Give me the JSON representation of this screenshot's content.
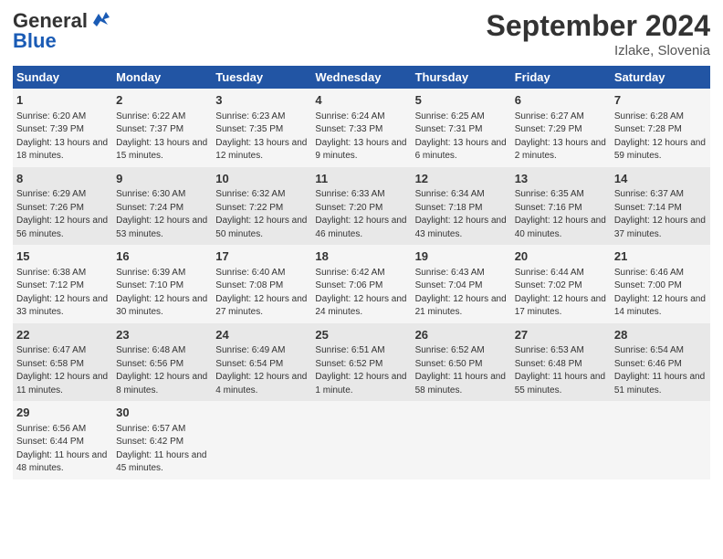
{
  "header": {
    "logo_line1": "General",
    "logo_line2": "Blue",
    "month_title": "September 2024",
    "location": "Izlake, Slovenia"
  },
  "days_of_week": [
    "Sunday",
    "Monday",
    "Tuesday",
    "Wednesday",
    "Thursday",
    "Friday",
    "Saturday"
  ],
  "weeks": [
    [
      {
        "day": "1",
        "sunrise": "Sunrise: 6:20 AM",
        "sunset": "Sunset: 7:39 PM",
        "daylight": "Daylight: 13 hours and 18 minutes."
      },
      {
        "day": "2",
        "sunrise": "Sunrise: 6:22 AM",
        "sunset": "Sunset: 7:37 PM",
        "daylight": "Daylight: 13 hours and 15 minutes."
      },
      {
        "day": "3",
        "sunrise": "Sunrise: 6:23 AM",
        "sunset": "Sunset: 7:35 PM",
        "daylight": "Daylight: 13 hours and 12 minutes."
      },
      {
        "day": "4",
        "sunrise": "Sunrise: 6:24 AM",
        "sunset": "Sunset: 7:33 PM",
        "daylight": "Daylight: 13 hours and 9 minutes."
      },
      {
        "day": "5",
        "sunrise": "Sunrise: 6:25 AM",
        "sunset": "Sunset: 7:31 PM",
        "daylight": "Daylight: 13 hours and 6 minutes."
      },
      {
        "day": "6",
        "sunrise": "Sunrise: 6:27 AM",
        "sunset": "Sunset: 7:29 PM",
        "daylight": "Daylight: 13 hours and 2 minutes."
      },
      {
        "day": "7",
        "sunrise": "Sunrise: 6:28 AM",
        "sunset": "Sunset: 7:28 PM",
        "daylight": "Daylight: 12 hours and 59 minutes."
      }
    ],
    [
      {
        "day": "8",
        "sunrise": "Sunrise: 6:29 AM",
        "sunset": "Sunset: 7:26 PM",
        "daylight": "Daylight: 12 hours and 56 minutes."
      },
      {
        "day": "9",
        "sunrise": "Sunrise: 6:30 AM",
        "sunset": "Sunset: 7:24 PM",
        "daylight": "Daylight: 12 hours and 53 minutes."
      },
      {
        "day": "10",
        "sunrise": "Sunrise: 6:32 AM",
        "sunset": "Sunset: 7:22 PM",
        "daylight": "Daylight: 12 hours and 50 minutes."
      },
      {
        "day": "11",
        "sunrise": "Sunrise: 6:33 AM",
        "sunset": "Sunset: 7:20 PM",
        "daylight": "Daylight: 12 hours and 46 minutes."
      },
      {
        "day": "12",
        "sunrise": "Sunrise: 6:34 AM",
        "sunset": "Sunset: 7:18 PM",
        "daylight": "Daylight: 12 hours and 43 minutes."
      },
      {
        "day": "13",
        "sunrise": "Sunrise: 6:35 AM",
        "sunset": "Sunset: 7:16 PM",
        "daylight": "Daylight: 12 hours and 40 minutes."
      },
      {
        "day": "14",
        "sunrise": "Sunrise: 6:37 AM",
        "sunset": "Sunset: 7:14 PM",
        "daylight": "Daylight: 12 hours and 37 minutes."
      }
    ],
    [
      {
        "day": "15",
        "sunrise": "Sunrise: 6:38 AM",
        "sunset": "Sunset: 7:12 PM",
        "daylight": "Daylight: 12 hours and 33 minutes."
      },
      {
        "day": "16",
        "sunrise": "Sunrise: 6:39 AM",
        "sunset": "Sunset: 7:10 PM",
        "daylight": "Daylight: 12 hours and 30 minutes."
      },
      {
        "day": "17",
        "sunrise": "Sunrise: 6:40 AM",
        "sunset": "Sunset: 7:08 PM",
        "daylight": "Daylight: 12 hours and 27 minutes."
      },
      {
        "day": "18",
        "sunrise": "Sunrise: 6:42 AM",
        "sunset": "Sunset: 7:06 PM",
        "daylight": "Daylight: 12 hours and 24 minutes."
      },
      {
        "day": "19",
        "sunrise": "Sunrise: 6:43 AM",
        "sunset": "Sunset: 7:04 PM",
        "daylight": "Daylight: 12 hours and 21 minutes."
      },
      {
        "day": "20",
        "sunrise": "Sunrise: 6:44 AM",
        "sunset": "Sunset: 7:02 PM",
        "daylight": "Daylight: 12 hours and 17 minutes."
      },
      {
        "day": "21",
        "sunrise": "Sunrise: 6:46 AM",
        "sunset": "Sunset: 7:00 PM",
        "daylight": "Daylight: 12 hours and 14 minutes."
      }
    ],
    [
      {
        "day": "22",
        "sunrise": "Sunrise: 6:47 AM",
        "sunset": "Sunset: 6:58 PM",
        "daylight": "Daylight: 12 hours and 11 minutes."
      },
      {
        "day": "23",
        "sunrise": "Sunrise: 6:48 AM",
        "sunset": "Sunset: 6:56 PM",
        "daylight": "Daylight: 12 hours and 8 minutes."
      },
      {
        "day": "24",
        "sunrise": "Sunrise: 6:49 AM",
        "sunset": "Sunset: 6:54 PM",
        "daylight": "Daylight: 12 hours and 4 minutes."
      },
      {
        "day": "25",
        "sunrise": "Sunrise: 6:51 AM",
        "sunset": "Sunset: 6:52 PM",
        "daylight": "Daylight: 12 hours and 1 minute."
      },
      {
        "day": "26",
        "sunrise": "Sunrise: 6:52 AM",
        "sunset": "Sunset: 6:50 PM",
        "daylight": "Daylight: 11 hours and 58 minutes."
      },
      {
        "day": "27",
        "sunrise": "Sunrise: 6:53 AM",
        "sunset": "Sunset: 6:48 PM",
        "daylight": "Daylight: 11 hours and 55 minutes."
      },
      {
        "day": "28",
        "sunrise": "Sunrise: 6:54 AM",
        "sunset": "Sunset: 6:46 PM",
        "daylight": "Daylight: 11 hours and 51 minutes."
      }
    ],
    [
      {
        "day": "29",
        "sunrise": "Sunrise: 6:56 AM",
        "sunset": "Sunset: 6:44 PM",
        "daylight": "Daylight: 11 hours and 48 minutes."
      },
      {
        "day": "30",
        "sunrise": "Sunrise: 6:57 AM",
        "sunset": "Sunset: 6:42 PM",
        "daylight": "Daylight: 11 hours and 45 minutes."
      },
      null,
      null,
      null,
      null,
      null
    ]
  ]
}
